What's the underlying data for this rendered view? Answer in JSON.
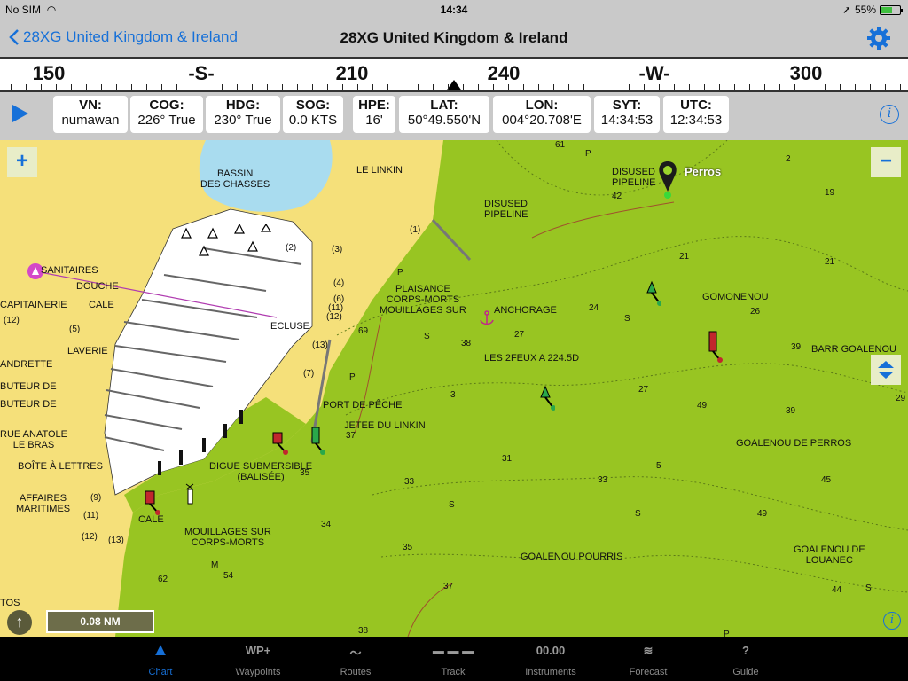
{
  "status": {
    "carrier": "No SIM",
    "time": "14:34",
    "battery": "55%",
    "battery_level": 0.55
  },
  "nav": {
    "back_label": "28XG United Kingdom & Ireland",
    "title": "28XG United Kingdom & Ireland"
  },
  "compass": {
    "labels": [
      "150",
      "-S-",
      "210",
      "240",
      "-W-",
      "300"
    ]
  },
  "info": {
    "vn": {
      "key": "VN:",
      "value": "numawan"
    },
    "cog": {
      "key": "COG:",
      "value": "226° True"
    },
    "hdg": {
      "key": "HDG:",
      "value": "230° True"
    },
    "sog": {
      "key": "SOG:",
      "value": "0.0 KTS"
    },
    "hpe": {
      "key": "HPE:",
      "value": "16'"
    },
    "lat": {
      "key": "LAT:",
      "value": "50°49.550'N"
    },
    "lon": {
      "key": "LON:",
      "value": "004°20.708'E"
    },
    "syt": {
      "key": "SYT:",
      "value": "14:34:53"
    },
    "utc": {
      "key": "UTC:",
      "value": "12:34:53"
    }
  },
  "map": {
    "scale": "0.08 NM",
    "labels": {
      "bassin": "BASSIN\nDES CHASSES",
      "le_linkin": "LE LINKIN",
      "disused_pipeline_1": "DISUSED\nPIPELINE",
      "disused_pipeline_2": "DISUSED\nPIPELINE",
      "perros": "Perros",
      "sanitaires": "SANITAIRES",
      "douche": "DOUCHE",
      "capitainerie": "CAPITAINERIE",
      "cale_1": "CALE",
      "laverie": "LAVERIE",
      "ecluse": "ECLUSE",
      "plaisance": "PLAISANCE\nCORPS-MORTS\nMOUILLAGES SUR",
      "anchorage": "ANCHORAGE",
      "gomonenou": "GOMONENOU",
      "barr_goalenou": "BARR GOALENOU",
      "les_2feux": "LES 2FEUX A 224.5D",
      "andrette": "ANDRETTE",
      "buteur_1": "BUTEUR DE",
      "buteur_2": "BUTEUR DE",
      "port_de_peche": "PORT DE PÊCHE",
      "jetee": "JETEE DU LINKIN",
      "rue_anatole": "RUE ANATOLE\nLE BRAS",
      "boite": "BOÎTE À LETTRES",
      "digue": "DIGUE SUBMERSIBLE\n(BALISÉE)",
      "goalenou_perros": "GOALENOU DE PERROS",
      "affaires": "AFFAIRES\nMARITIMES",
      "cale_2": "CALE",
      "mouillages": "MOUILLAGES SUR\nCORPS-MORTS",
      "goalenou_pourris": "GOALENOU POURRIS",
      "goalenou_louanec": "GOALENOU DE\nLOUANEC",
      "tos": "TOS"
    },
    "depths": [
      {
        "t": "61",
        "pos": "p1"
      },
      {
        "t": "P",
        "pos": "p2"
      },
      {
        "t": "2",
        "pos": "p3"
      },
      {
        "t": "19",
        "pos": "p4"
      },
      {
        "t": "42",
        "pos": "p5"
      },
      {
        "t": "21",
        "pos": "p6"
      },
      {
        "t": "21",
        "pos": "p7"
      },
      {
        "t": "(1)",
        "pos": "p8"
      },
      {
        "t": "(2)",
        "pos": "p9"
      },
      {
        "t": "(3)",
        "pos": "p10"
      },
      {
        "t": "(4)",
        "pos": "p11"
      },
      {
        "t": "(6)",
        "pos": "p12"
      },
      {
        "t": "(11)",
        "pos": "p13"
      },
      {
        "t": "(12)",
        "pos": "p14"
      },
      {
        "t": "(12)",
        "pos": "p15"
      },
      {
        "t": "(5)",
        "pos": "p16"
      },
      {
        "t": "(13)",
        "pos": "p17"
      },
      {
        "t": "(7)",
        "pos": "p18"
      },
      {
        "t": "P",
        "pos": "p19"
      },
      {
        "t": "24",
        "pos": "p20"
      },
      {
        "t": "S",
        "pos": "p21"
      },
      {
        "t": "26",
        "pos": "p22"
      },
      {
        "t": "69",
        "pos": "p23"
      },
      {
        "t": "S",
        "pos": "p24"
      },
      {
        "t": "38",
        "pos": "p25"
      },
      {
        "t": "27",
        "pos": "p26"
      },
      {
        "t": "39",
        "pos": "p27"
      },
      {
        "t": "P",
        "pos": "p28"
      },
      {
        "t": "3",
        "pos": "p29"
      },
      {
        "t": "27",
        "pos": "p30"
      },
      {
        "t": "49",
        "pos": "p31"
      },
      {
        "t": "39",
        "pos": "p32"
      },
      {
        "t": "29",
        "pos": "p33"
      },
      {
        "t": "37",
        "pos": "p34"
      },
      {
        "t": "31",
        "pos": "p35"
      },
      {
        "t": "5",
        "pos": "p36"
      },
      {
        "t": "35",
        "pos": "p37"
      },
      {
        "t": "33",
        "pos": "p38"
      },
      {
        "t": "33",
        "pos": "p39"
      },
      {
        "t": "45",
        "pos": "p40"
      },
      {
        "t": "(9)",
        "pos": "p41"
      },
      {
        "t": "(11)",
        "pos": "p42"
      },
      {
        "t": "S",
        "pos": "p43"
      },
      {
        "t": "S",
        "pos": "p44"
      },
      {
        "t": "49",
        "pos": "p45"
      },
      {
        "t": "(12)",
        "pos": "p46"
      },
      {
        "t": "(13)",
        "pos": "p47"
      },
      {
        "t": "34",
        "pos": "p48"
      },
      {
        "t": "35",
        "pos": "p49"
      },
      {
        "t": "M",
        "pos": "p50"
      },
      {
        "t": "54",
        "pos": "p51"
      },
      {
        "t": "62",
        "pos": "p52"
      },
      {
        "t": "37",
        "pos": "p53"
      },
      {
        "t": "44",
        "pos": "p54"
      },
      {
        "t": "S",
        "pos": "p55"
      },
      {
        "t": "38",
        "pos": "p56"
      },
      {
        "t": "P",
        "pos": "p57"
      },
      {
        "t": "(12)",
        "pos": "p58"
      }
    ]
  },
  "tabs": [
    {
      "icon": "▲",
      "label": "Chart"
    },
    {
      "icon": "WP+",
      "label": "Waypoints"
    },
    {
      "icon": "〜",
      "label": "Routes"
    },
    {
      "icon": "▬ ▬ ▬",
      "label": "Track"
    },
    {
      "icon": "00.00",
      "label": "Instruments"
    },
    {
      "icon": "≋",
      "label": "Forecast"
    },
    {
      "icon": "?",
      "label": "Guide"
    }
  ],
  "colors": {
    "accent": "#1670d8",
    "water": "#98c522",
    "land": "#f5e07a",
    "harbor": "#ffffff",
    "basin": "#a9dcef"
  }
}
